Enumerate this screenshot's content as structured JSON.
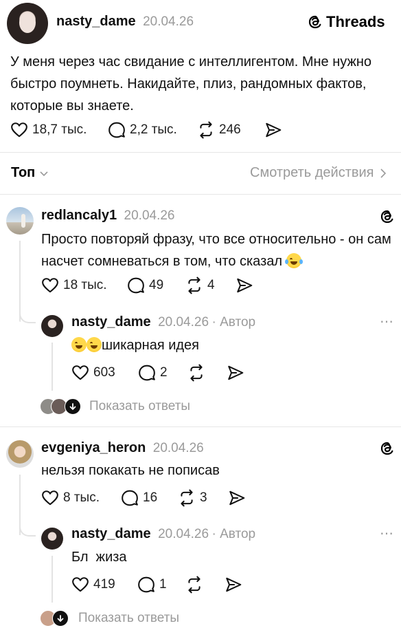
{
  "post": {
    "username": "nasty_dame",
    "date": "20.04.26",
    "platform": "Threads",
    "text": "У меня через час свидание с интеллигентом. Мне нужно быстро поумнеть. Накидайте, плиз, рандомных фактов, которые вы знаете.",
    "likes": "18,7 тыс.",
    "comments": "2,2 тыс.",
    "reposts": "246"
  },
  "filter": {
    "sort_label": "Топ",
    "activity_label": "Смотреть действия"
  },
  "replies": [
    {
      "username": "redlancaly1",
      "date": "20.04.26",
      "text": "Просто повторяй фразу, что все относительно - он сам насчет сомневаться в том, что сказал",
      "likes": "18 тыс.",
      "comments": "49",
      "reposts": "4",
      "sub": {
        "username": "nasty_dame",
        "date": "20.04.26",
        "author_badge": "· Автор",
        "text": "шикарная идея",
        "likes": "603",
        "comments": "2"
      },
      "show_replies": "Показать ответы"
    },
    {
      "username": "evgeniya_heron",
      "date": "20.04.26",
      "text": "нельзя покакать не пописав",
      "likes": "8 тыс.",
      "comments": "16",
      "reposts": "3",
      "sub": {
        "username": "nasty_dame",
        "date": "20.04.26",
        "author_badge": "· Автор",
        "text": "Бл  жиза",
        "likes": "419",
        "comments": "1"
      },
      "show_replies": "Показать ответы"
    }
  ],
  "colors": {
    "muted": "#9a9a9a",
    "divider": "#e6e6e6",
    "text": "#111111"
  }
}
